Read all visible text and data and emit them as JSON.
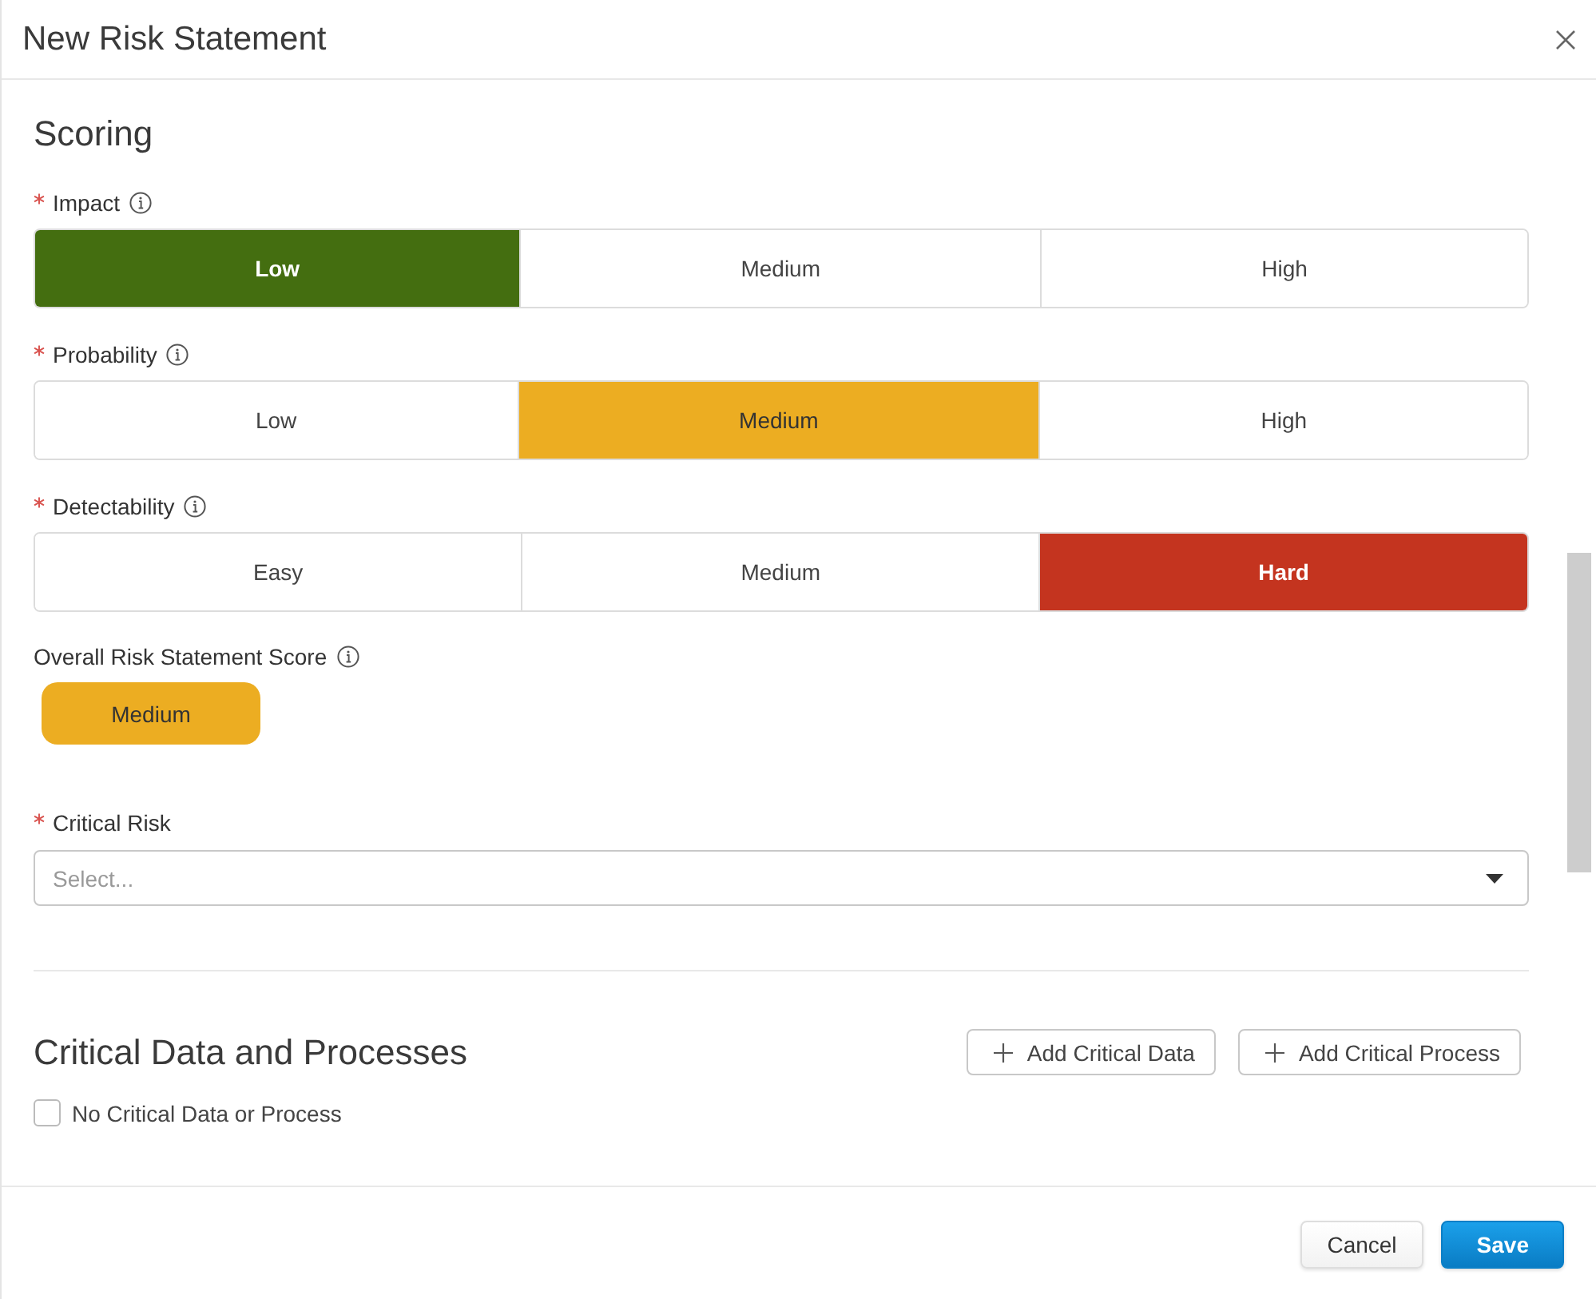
{
  "dialog": {
    "title": "New Risk Statement"
  },
  "scoring": {
    "heading": "Scoring",
    "scales": [
      {
        "label": "Impact",
        "required": true,
        "info_icon": true,
        "options": [
          {
            "label": "Low",
            "selected": true
          },
          {
            "label": "Medium",
            "selected": false
          },
          {
            "label": "High",
            "selected": false
          }
        ]
      },
      {
        "label": "Probability",
        "required": true,
        "info_icon": true,
        "options": [
          {
            "label": "Low",
            "selected": false
          },
          {
            "label": "Medium",
            "selected": true
          },
          {
            "label": "High",
            "selected": false
          }
        ]
      },
      {
        "label": "Detectability",
        "required": true,
        "info_icon": true,
        "options": [
          {
            "label": "Easy",
            "selected": false
          },
          {
            "label": "Medium",
            "selected": false
          },
          {
            "label": "Hard",
            "selected": true
          }
        ]
      }
    ],
    "score": {
      "label": "Overall Risk Statement Score",
      "info_icon": true,
      "value": "Medium",
      "color": "#ecad22"
    },
    "critical_risk": {
      "label": "Critical Risk",
      "required": true,
      "placeholder": "Select..."
    }
  },
  "critical_data": {
    "heading": "Critical Data and Processes",
    "buttons": [
      "Add Critical Data",
      "Add Critical Process"
    ],
    "checkbox": {
      "label": "No Critical Data or Process",
      "checked": false
    }
  },
  "footer": {
    "buttons": [
      {
        "label": "Cancel",
        "kind": "secondary"
      },
      {
        "label": "Save",
        "kind": "primary"
      }
    ]
  }
}
